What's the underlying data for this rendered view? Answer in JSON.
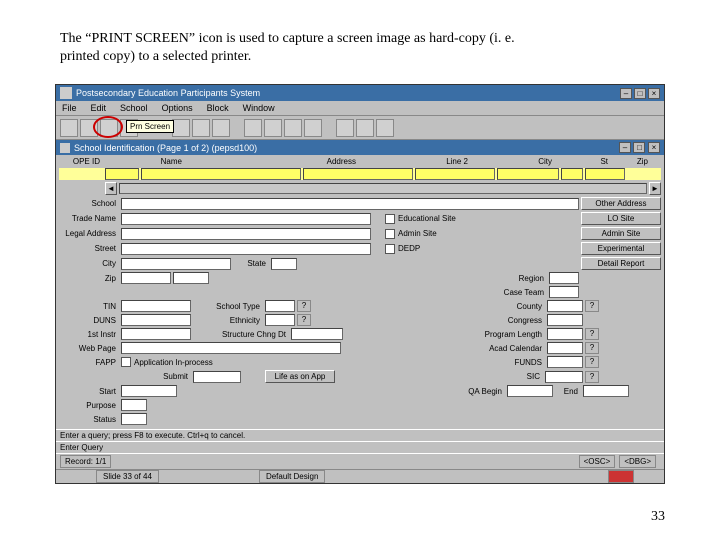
{
  "caption": {
    "line1": "The “PRINT SCREEN” icon is used to capture a screen image as hard-copy (i. e.",
    "line2": "printed copy) to a selected printer."
  },
  "page_number": "33",
  "titlebar": {
    "text": "Postsecondary Education Participants System"
  },
  "menubar": {
    "file": "File",
    "edit": "Edit",
    "school": "School",
    "options": "Options",
    "block": "Block",
    "window": "Window"
  },
  "tooltip": "Prn Screen",
  "subtitle": "School Identification (Page 1 of 2) (pepsd100)",
  "labels": {
    "ope_id": "OPE ID",
    "name": "Name",
    "address": "Address",
    "line2": "Line 2",
    "city": "City",
    "st": "St",
    "zip": "Zip",
    "school": "School",
    "trade_name": "Trade Name",
    "legal_address": "Legal Address",
    "street": "Street",
    "cityL": "City",
    "zipL": "Zip",
    "state": "State",
    "tin": "TIN",
    "duns": "DUNS",
    "first_instr": "1st Instr",
    "web_page": "Web Page",
    "fapp": "FAPP",
    "school_type": "School Type",
    "ethnicity": "Ethnicity",
    "structure_chng_dt": "Structure Chng Dt",
    "educational_site": "Educational Site",
    "admin_site": "Admin Site",
    "dedp": "DEDP",
    "other_address": "Other Address",
    "lo_site": "LO Site",
    "admin_site_btn": "Admin Site",
    "experimental": "Experimental",
    "detail_report": "Detail Report",
    "region": "Region",
    "case_team": "Case Team",
    "county": "County",
    "congress": "Congress",
    "program_length": "Program Length",
    "acad_calendar": "Acad Calendar",
    "funds": "FUNDS",
    "app_inprocess": "Application In-process",
    "submit": "Submit",
    "life_as_on_app": "Life as on App",
    "sic": "SIC",
    "start": "Start",
    "purpose": "Purpose",
    "status": "Status",
    "qa_begin": "QA Begin",
    "end": "End"
  },
  "footer": {
    "hint1": "Enter a query; press F8 to execute. Ctrl+q to cancel.",
    "hint2": "Enter Query",
    "record": "Record: 1/1",
    "osc": "<OSC>",
    "dbg": "<DBG>"
  },
  "taskbar": {
    "slide": "Slide 33 of 44",
    "design": "Default Design"
  },
  "win": {
    "min": "–",
    "max": "□",
    "close": "×"
  },
  "q": "?",
  "scroll_left": "◄",
  "scroll_right": "►"
}
